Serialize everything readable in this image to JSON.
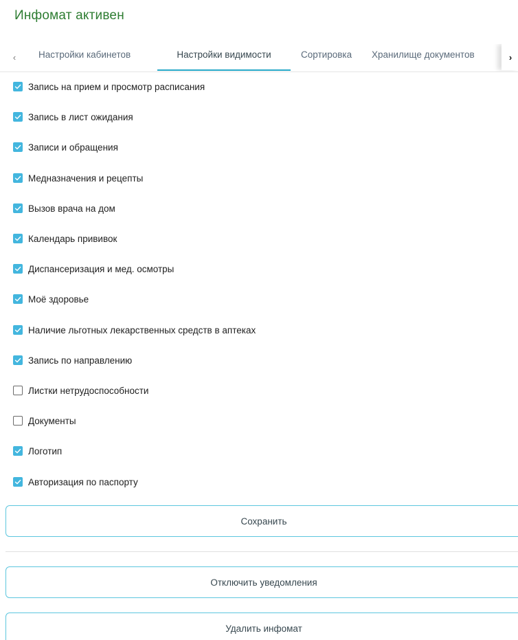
{
  "header": {
    "title": "Инфомат активен"
  },
  "tabs": {
    "prev_icon": "chevron-left-icon",
    "next_icon": "chevron-right-icon",
    "items": [
      {
        "label": "Настройки кабинетов",
        "active": false
      },
      {
        "label": "Настройки видимости",
        "active": true
      },
      {
        "label": "Сортировка",
        "active": false
      },
      {
        "label": "Хранилище документов",
        "active": false
      }
    ]
  },
  "options": [
    {
      "label": "Запись на прием и просмотр расписания",
      "checked": true
    },
    {
      "label": "Запись в лист ожидания",
      "checked": true
    },
    {
      "label": "Записи и обращения",
      "checked": true
    },
    {
      "label": "Медназначения и рецепты",
      "checked": true
    },
    {
      "label": "Вызов врача на дом",
      "checked": true
    },
    {
      "label": "Календарь прививок",
      "checked": true
    },
    {
      "label": "Диспансеризация и мед. осмотры",
      "checked": true
    },
    {
      "label": "Моё здоровье",
      "checked": true
    },
    {
      "label": "Наличие льготных лекарственных средств в аптеках",
      "checked": true
    },
    {
      "label": "Запись по направлению",
      "checked": true
    },
    {
      "label": "Листки нетрудоспособности",
      "checked": false
    },
    {
      "label": "Документы",
      "checked": false
    },
    {
      "label": "Логотип",
      "checked": true
    },
    {
      "label": "Авторизация по паспорту",
      "checked": true
    }
  ],
  "actions": {
    "save_label": "Сохранить",
    "disable_notifications_label": "Отключить уведомления",
    "delete_label": "Удалить инфомат"
  },
  "colors": {
    "title": "#2e7d32",
    "accent": "#43b6de",
    "active_tab_underline": "#26a8c8",
    "button_border": "#5cc6de"
  }
}
